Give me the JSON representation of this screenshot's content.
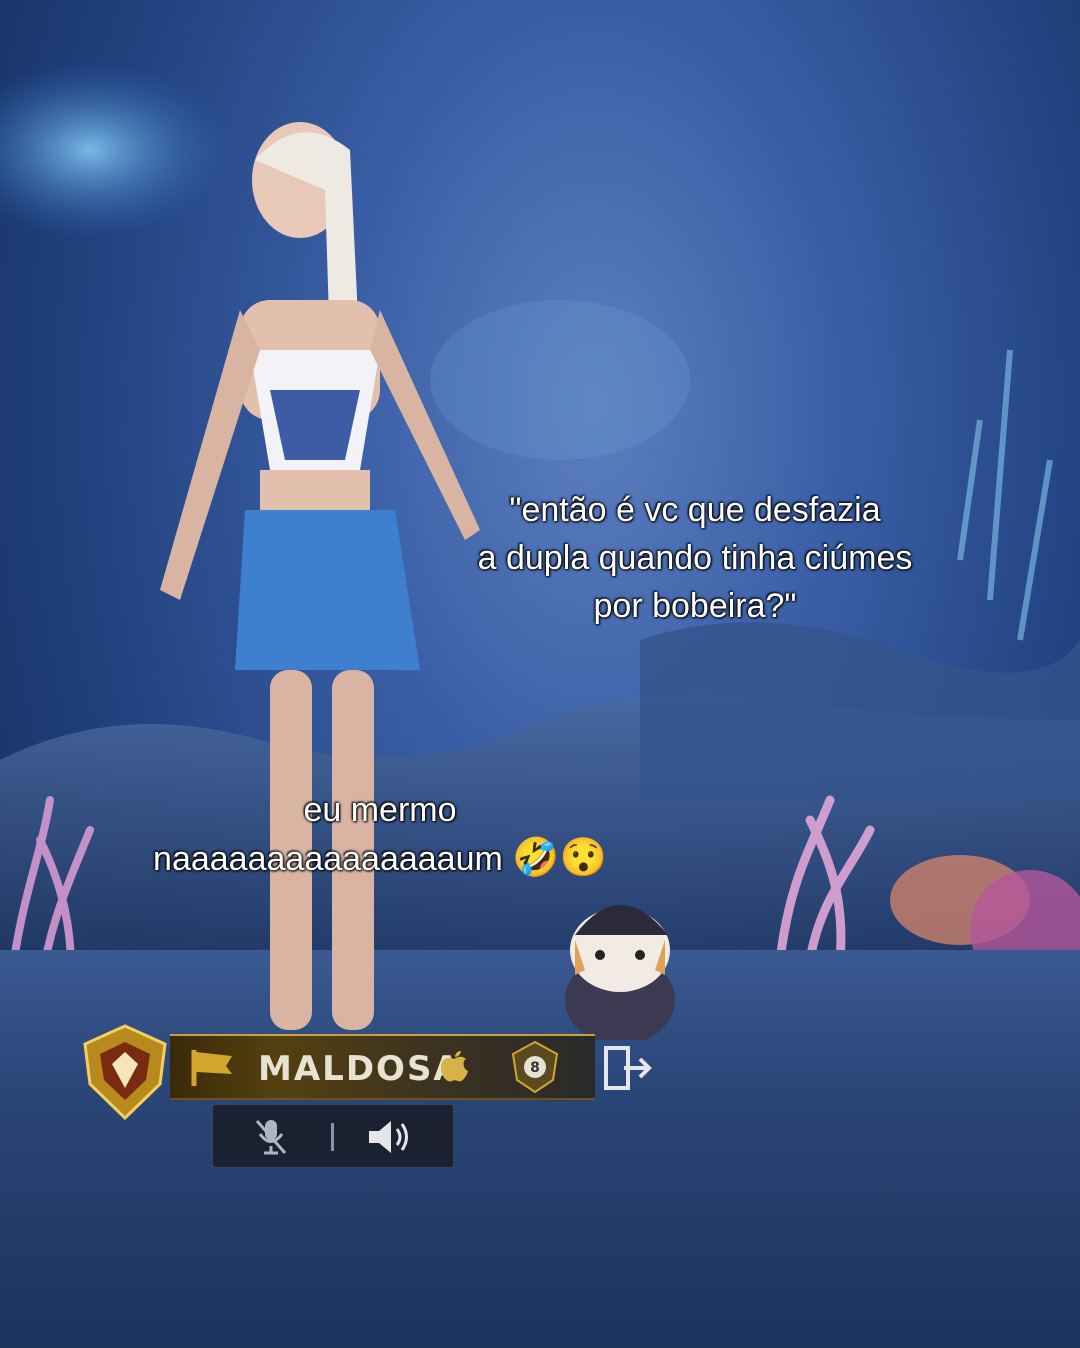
{
  "caption_top": [
    "\"então é vc que desfazia",
    "a dupla quando tinha ciúmes",
    "por bobeira?\""
  ],
  "caption_bottom": {
    "line1": "eu mermo",
    "line2": "naaaaaaaaaaaaaaaum",
    "emoji1": "🤣",
    "emoji2": "😯"
  },
  "player": {
    "name": "MALDOSA",
    "rank_number": "8"
  },
  "icons": [
    "rank-badge-icon",
    "flag-icon",
    "apple-icon",
    "rank-emblem-icon",
    "exit-icon",
    "mic-muted-icon",
    "speaker-icon"
  ]
}
